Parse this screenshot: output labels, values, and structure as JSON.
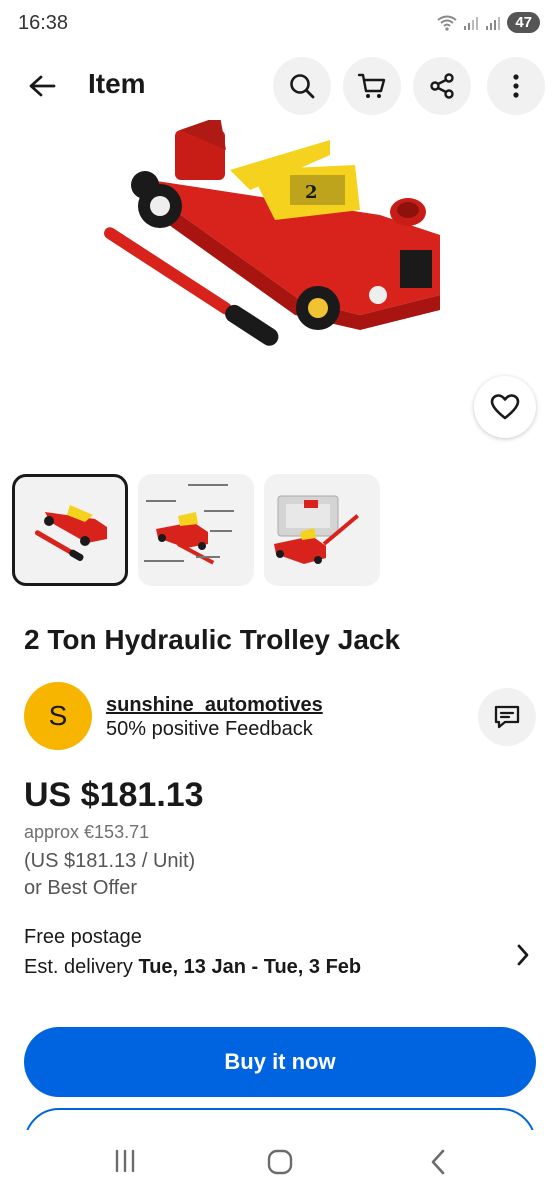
{
  "status_bar": {
    "time": "16:38",
    "battery": "47",
    "icons": [
      "wifi-icon",
      "signal-roaming-icon",
      "signal-icon",
      "battery-icon"
    ]
  },
  "app_bar": {
    "title": "Item",
    "icons": [
      "back-arrow-icon",
      "search-icon",
      "cart-icon",
      "share-icon",
      "more-vertical-icon"
    ]
  },
  "listing": {
    "title": "2 Ton Hydraulic Trolley Jack",
    "thumbnails": [
      "jack-photo",
      "jack-diagram",
      "jack-with-case"
    ],
    "selected_thumbnail": 0
  },
  "seller": {
    "initial": "S",
    "name": "sunshine_automotives",
    "feedback": "50% positive Feedback"
  },
  "pricing": {
    "price": "US $181.13",
    "approx": "approx €153.71",
    "unit_price": "(US $181.13 / Unit)",
    "offer": "or Best Offer"
  },
  "shipping": {
    "postage": "Free postage",
    "delivery_prefix": "Est. delivery ",
    "delivery_dates": "Tue, 13 Jan - Tue, 3 Feb"
  },
  "actions": {
    "buy_now": "Buy it now"
  },
  "colors": {
    "accent": "#0064e0",
    "avatar": "#f7b500",
    "jack_red": "#d8231c",
    "jack_yellow": "#f4d21e"
  }
}
